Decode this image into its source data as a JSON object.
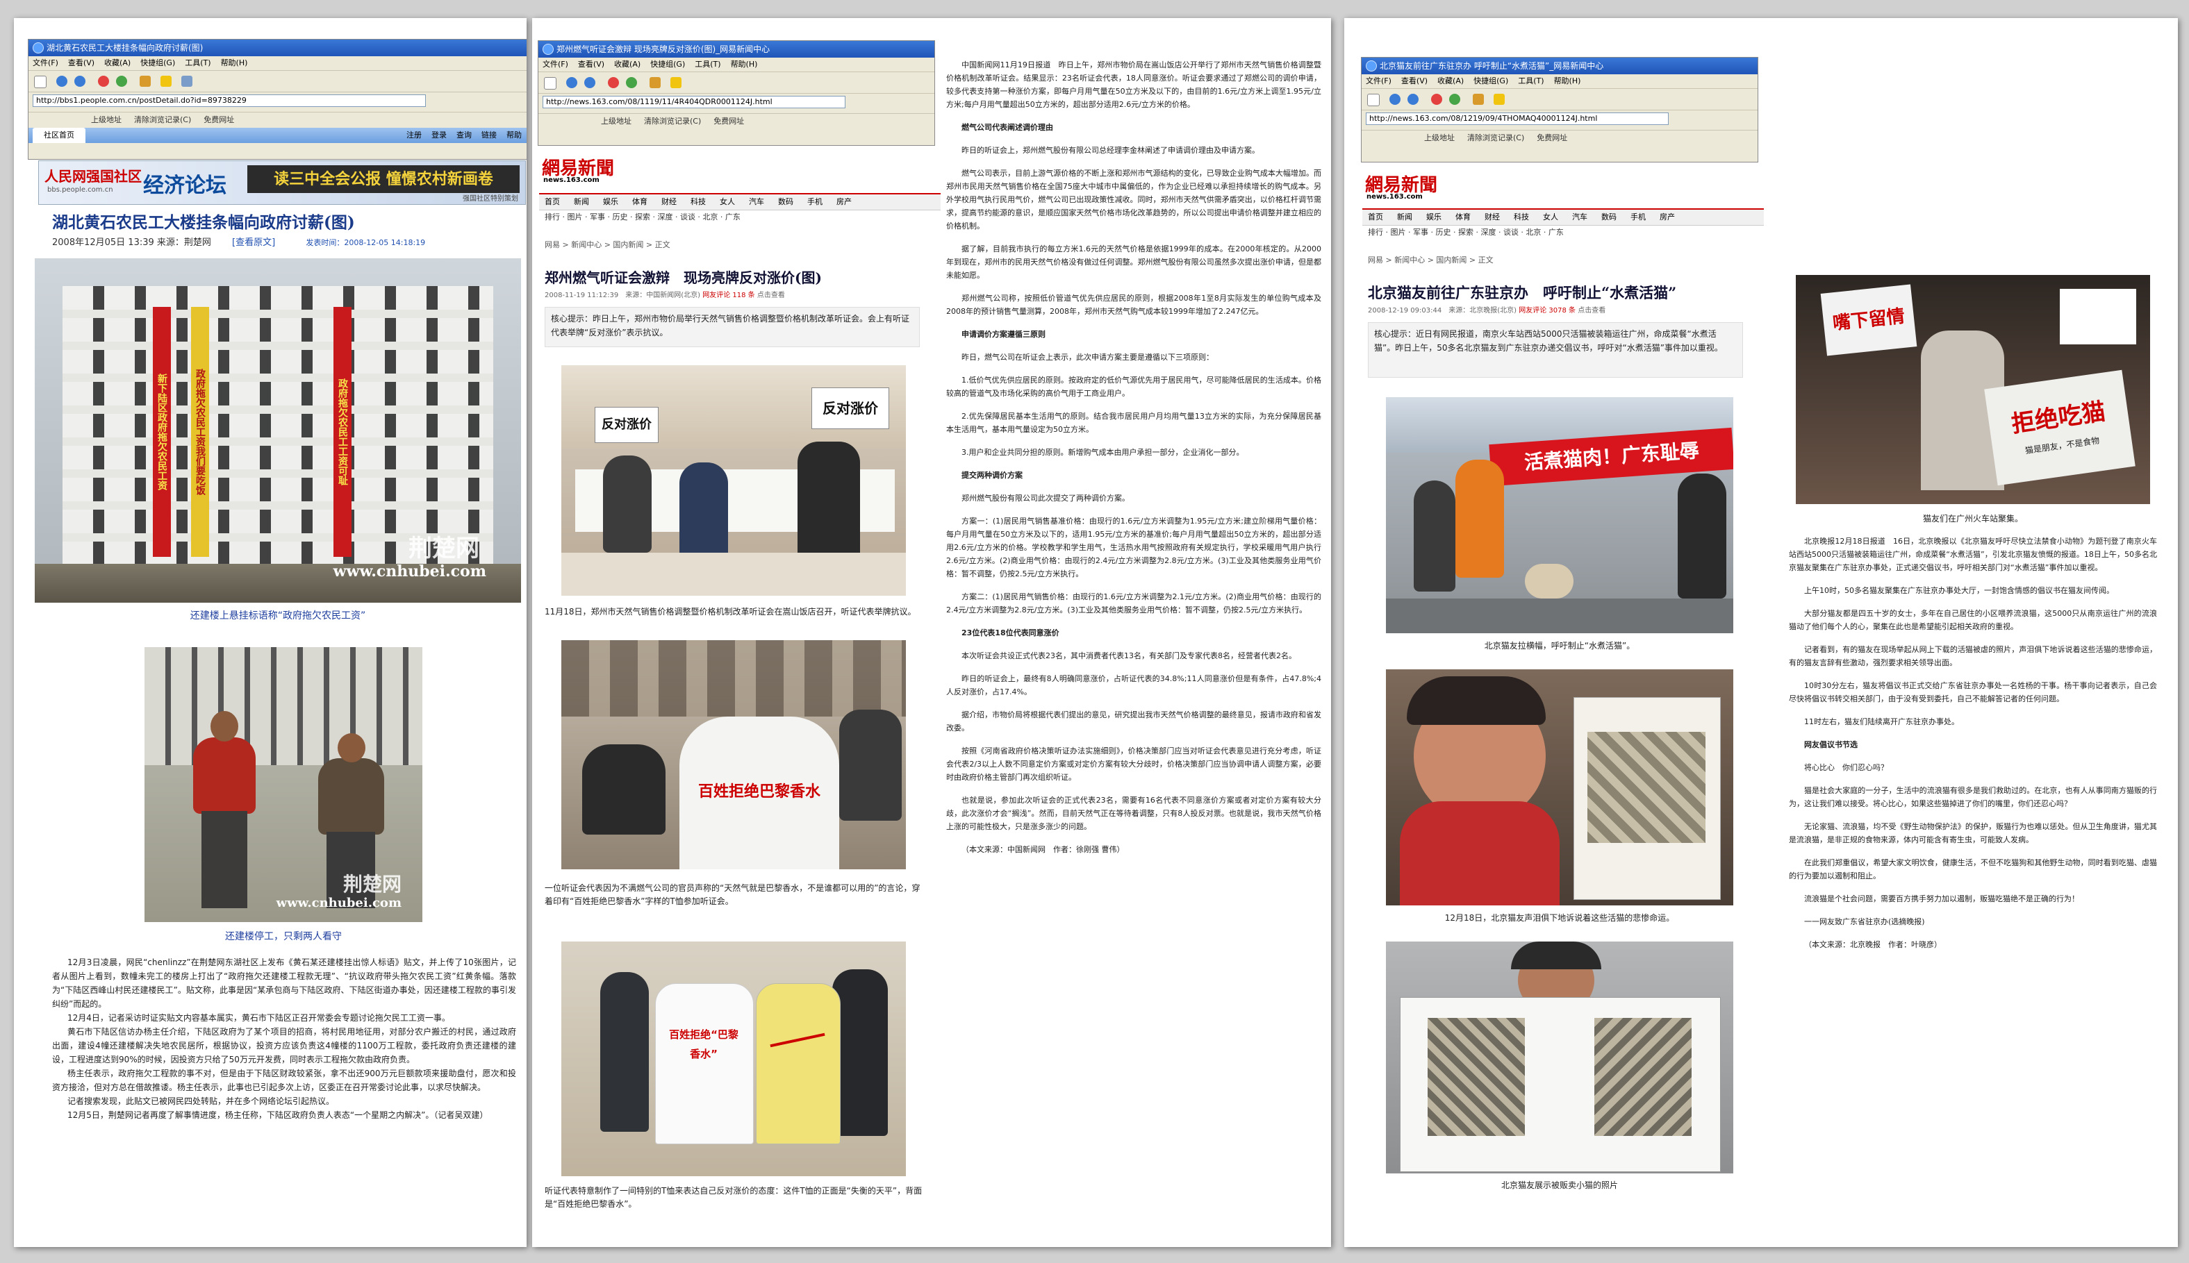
{
  "p1": {
    "window_title": "湖北黄石农民工大楼挂条幅向政府讨薪(图)",
    "menu": [
      "文件(F)",
      "查看(V)",
      "收藏(A)",
      "快捷组(G)",
      "工具(T)",
      "帮助(H)"
    ],
    "address": "http://bbs1.people.com.cn/postDetail.do?id=89738229",
    "links": [
      "上级地址",
      "清除浏览记录(C)",
      "免费网址"
    ],
    "tab_label": "社区首页",
    "tab_links": [
      "注册",
      "登录",
      "查询",
      "链接",
      "帮助"
    ],
    "banner_site": "人民网强国社区",
    "banner_site_url": "bbs.people.com.cn",
    "banner_section": "经济论坛",
    "banner_slogan": "读三中全会公报 憧憬农村新画卷",
    "banner_note": "强国社区特别策划",
    "headline": "湖北黄石农民工大楼挂条幅向政府讨薪(图)",
    "meta_date": "2008年12月05日 13:39 来源：荆楚网",
    "meta_view": "[查看原文]",
    "meta_post": "发表时间：2008-12-05 14:18:19",
    "banner_texts": [
      "新下陆区政府拖欠农民工资",
      "政府拖欠农民工资我们要吃饭",
      "政府拖欠农民工工资可耻"
    ],
    "watermark_logo": "荆楚网",
    "watermark_url": "www.cnhubei.com",
    "cap1": "还建楼上悬挂标语称“政府拖欠农民工资”",
    "cap2": "还建楼停工，只剩两人看守",
    "paras": [
      "12月3日凌晨，网民“chenlinzz”在荆楚网东湖社区上发布《黄石某还建楼挂出惊人标语》贴文，并上传了10张图片，记者从图片上看到，数幢未完工的楼房上打出了“政府拖欠还建楼工程款无理”、“抗议政府带头拖欠农民工资”红黄条幅。落款为“下陆区西峰山村民还建楼民工”。贴文称，此事是因“某承包商与下陆区政府、下陆区街道办事处，因还建楼工程款的事引发纠纷”而起的。",
      "12月4日，记者采访时证实贴文内容基本属实，黄石市下陆区正召开常委会专题讨论拖欠民工工资一事。",
      "黄石市下陆区信访办杨主任介绍，下陆区政府为了某个项目的招商，将村民用地征用，对部分农户搬迁的村民，通过政府出面，建设4幢还建楼解决失地农民居所，根据协议，投资方应该负责这4幢楼的1100万工程款，委托政府负责还建楼的建设，工程进度达到90%的时候，因投资方只给了50万元开发费，同时表示工程拖欠款由政府负责。",
      "杨主任表示，政府拖欠工程款的事不对，但是由于下陆区财政较紧张，拿不出还900万元巨额款项来援助盘付，愿次和投资方接洽，但对方总在借故推诿。杨主任表示，此事也已引起多次上访，区委正在召开常委讨论此事，以求尽快解决。",
      "记者搜索发现，此贴文已被网民四处转贴，并在多个网络论坛引起热议。",
      "12月5日，荆楚网记者再度了解事情进度，杨主任称，下陆区政府负责人表态“一个星期之内解决”。（记者吴双建）"
    ]
  },
  "p2": {
    "window_title": "郑州燃气听证会激辩 现场亮牌反对涨价(图)_网易新闻中心",
    "menu": [
      "文件(F)",
      "查看(V)",
      "收藏(A)",
      "快捷组(G)",
      "工具(T)",
      "帮助(H)"
    ],
    "address": "http://news.163.com/08/1119/11/4R404QDR0001124J.html",
    "links": [
      "上级地址",
      "清除浏览记录(C)",
      "免费网址"
    ],
    "logo": "網易新聞",
    "logo_sub": "news.163.com",
    "nav1": [
      "首页",
      "新闻",
      "娱乐",
      "体育",
      "财经",
      "科技",
      "女人",
      "汽车",
      "数码",
      "手机",
      "房产"
    ],
    "nav2": "排行 · 图片 · 军事 · 历史 · 探索 · 深度 · 谈谈 · 北京 · 广东",
    "crumb": "网易 > 新闻中心 > 国内新闻 > 正文",
    "headline": "郑州燃气听证会激辩　现场亮牌反对涨价(图)",
    "meta": "2008-11-19 11:12:39　来源：中国新闻网(北京)",
    "meta_red": "网友评论 118 条",
    "meta_tail": "点击查看",
    "summary": "核心提示：昨日上午，郑州市物价局举行天然气销售价格调整暨价格机制改革听证会。会上有听证代表举牌“反对涨价”表示抗议。",
    "sign1": "反对涨价",
    "sign2": "百姓拒绝巴黎香水",
    "shirt_text": "百姓拒绝“巴黎香水”",
    "cap1": "11月18日，郑州市天然气销售价格调整暨价格机制改革听证会在嵩山饭店召开，听证代表举牌抗议。",
    "cap2": "一位听证会代表因为不满燃气公司的官员声称的“天然气就是巴黎香水，不是谁都可以用的”的言论，穿着印有“百姓拒绝巴黎香水”字样的T恤参加听证会。",
    "cap3": "听证代表特意制作了一间特别的T恤来表达自己反对涨价的态度：这件T恤的正面是“失衡的天平”，背面是“百姓拒绝巴黎香水”。",
    "body": [
      {
        "h": false,
        "t": "中国新闻网11月19日报道　昨日上午，郑州市物价局在嵩山饭店公开举行了郑州市天然气销售价格调整暨价格机制改革听证会。结果显示：23名听证会代表，18人同意涨价。听证会要求通过了郑燃公司的调价申请，较多代表支持第一种涨价方案，即每户月用气量在50立方米及以下的，由目前的1.6元/立方米上调至1.95元/立方米;每户月用气量超出50立方米的，超出部分适用2.6元/立方米的价格。"
      },
      {
        "h": true,
        "t": "燃气公司代表阐述调价理由"
      },
      {
        "h": false,
        "t": "昨日的听证会上，郑州燃气股份有限公司总经理李金林阐述了申请调价理由及申请方案。"
      },
      {
        "h": false,
        "t": "燃气公司表示，目前上游气源价格的不断上涨和郑州市气源结构的变化，已导致企业购气成本大幅增加。而郑州市民用天然气销售价格在全国75座大中城市中属偏低的，作为企业已经难以承担持续增长的购气成本。另外学校用气执行民用气价，燃气公司已出现政策性减收。同时，郑州市天然气供需矛盾突出，以价格杠杆调节需求，提高节约能源的意识，是顺应国家天然气价格市场化改革趋势的，所以公司提出申请价格调整并建立相应的价格机制。"
      },
      {
        "h": false,
        "t": "据了解，目前我市执行的每立方米1.6元的天然气价格是依据1999年的成本。在2000年核定的。从2000年到现在，郑州市的民用天然气价格没有做过任何调整。郑州燃气股份有限公司虽然多次提出涨价申请，但是都未能如愿。"
      },
      {
        "h": false,
        "t": "郑州燃气公司称，按照低价管道气优先供应居民的原则，根据2008年1至8月实际发生的单位购气成本及2008年的预计销售气量测算，2008年，郑州市天然气购气成本较1999年增加了2.247亿元。"
      },
      {
        "h": true,
        "t": "申请调价方案遵循三原则"
      },
      {
        "h": false,
        "t": "昨日，燃气公司在听证会上表示，此次申请方案主要是遵循以下三项原则："
      },
      {
        "h": false,
        "t": "1.低价气优先供应居民的原则。按政府定的低价气源优先用于居民用气，尽可能降低居民的生活成本。价格较高的管道气及市场化采购的高价气用于工商业用户。"
      },
      {
        "h": false,
        "t": "2.优先保障居民基本生活用气的原则。结合我市居民用户月均用气量13立方米的实际，为充分保障居民基本生活用气，基本用气量设定为50立方米。"
      },
      {
        "h": false,
        "t": "3.用户和企业共同分担的原则。新增购气成本由用户承担一部分，企业消化一部分。"
      },
      {
        "h": true,
        "t": "提交两种调价方案"
      },
      {
        "h": false,
        "t": "郑州燃气股份有限公司此次提交了两种调价方案。"
      },
      {
        "h": false,
        "t": "方案一：(1)居民用气销售基准价格：由现行的1.6元/立方米调整为1.95元/立方米;建立阶梯用气量价格：每户月用气量在50立方米及以下的，适用1.95元/立方米的基准价;每户月用气量超出50立方米的，超出部分适用2.6元/立方米的价格。学校教学和学生用气，生活热水用气按照政府有关规定执行，学校采暖用气用户执行2.6元/立方米。(2)商业用气价格：由现行的2.4元/立方米调整为2.8元/立方米。(3)工业及其他类服务业用气价格：暂不调整，仍按2.5元/立方米执行。"
      },
      {
        "h": false,
        "t": "方案二：(1)居民用气销售价格：由现行的1.6元/立方米调整为2.1元/立方米。(2)商业用气价格：由现行的2.4元/立方米调整为2.8元/立方米。(3)工业及其他类服务业用气价格：暂不调整，仍按2.5元/立方米执行。"
      },
      {
        "h": true,
        "t": "23位代表18位代表同意涨价"
      },
      {
        "h": false,
        "t": "本次听证会共设正式代表23名，其中消费者代表13名，有关部门及专家代表8名，经营者代表2名。"
      },
      {
        "h": false,
        "t": "昨日的听证会上，最终有8人明确同意涨价，占听证代表的34.8%;11人同意涨价但是有条件，占47.8%;4人反对涨价，占17.4%。"
      },
      {
        "h": false,
        "t": "据介绍，市物价局将根据代表们提出的意见，研究提出我市天然气价格调整的最终意见，报请市政府和省发改委。"
      },
      {
        "h": false,
        "t": "按照《河南省政府价格决策听证办法实施细则》，价格决策部门应当对听证会代表意见进行充分考虑，听证会代表2/3以上人数不同意定价方案或对定价方案有较大分歧时，价格决策部门应当协调申请人调整方案，必要时由政府价格主管部门再次组织听证。"
      },
      {
        "h": false,
        "t": "也就是说，参加此次听证会的正式代表23名，需要有16名代表不同意涨价方案或者对定价方案有较大分歧，此次涨价才会“搁浅”。然而，目前天然气正在等待着调整，只有8人投反对票。也就是说，我市天然气价格上涨的可能性极大，只是涨多涨少的问题。"
      },
      {
        "h": false,
        "t": "（本文来源：中国新闻网　作者：徐刚强 曹伟）"
      }
    ]
  },
  "p3": {
    "window_title": "北京猫友前往广东驻京办 呼吁制止“水煮活猫”_网易新闻中心",
    "menu": [
      "文件(F)",
      "查看(V)",
      "收藏(A)",
      "快捷组(G)",
      "工具(T)",
      "帮助(H)"
    ],
    "address": "http://news.163.com/08/1219/09/4THOMAQ40001124J.html",
    "links": [
      "上级地址",
      "清除浏览记录(C)",
      "免费网址"
    ],
    "logo": "網易新聞",
    "logo_sub": "news.163.com",
    "nav1": [
      "首页",
      "新闻",
      "娱乐",
      "体育",
      "财经",
      "科技",
      "女人",
      "汽车",
      "数码",
      "手机",
      "房产"
    ],
    "nav2": "排行 · 图片 · 军事 · 历史 · 探索 · 深度 · 谈谈 · 北京 · 广东",
    "crumb": "网易 > 新闻中心 > 国内新闻 > 正文",
    "headline": "北京猫友前往广东驻京办　呼吁制止“水煮活猫”",
    "meta": "2008-12-19 09:03:44　来源：北京晚报(北京)",
    "meta_red": "网友评论 3078 条",
    "meta_tail": "点击查看",
    "summary": "核心提示：近日有网民报道，南京火车站西站5000只活猫被装箱运往广州，命成菜餐“水煮活猫”。昨日上午，50多名北京猫友到广东驻京办递交倡议书，呼吁对“水煮活猫”事件加以重视。",
    "banner_red": "活煮猫肉！广东耻辱",
    "sign_reject": "拒绝吃猫",
    "sign_reject_sub": "猫是朋友，不是食物",
    "sign_mouth": "嘴下留情",
    "cap1": "北京猫友拉横幅，呼吁制止“水煮活猫”。",
    "cap2": "12月18日，北京猫友声泪俱下地诉说着这些活猫的悲惨命运。",
    "cap3": "北京猫友展示被贩卖小猫的照片",
    "cap4": "猫友们在广州火车站聚集。",
    "body": [
      {
        "h": false,
        "t": "北京晚报12月18日报道　16日，北京晚报以《北京猫友呼吁尽快立法禁食小动物》为题刊登了南京火车站西站5000只活猫被装箱运往广州，命成菜餐“水煮活猫”，引发北京猫友愤慨的报道。18日上午，50多名北京猫友聚集在广东驻京办事处，正式递交倡议书，呼吁相关部门对“水煮活猫”事件加以重视。"
      },
      {
        "h": false,
        "t": "上午10时，50多名猫友聚集在广东驻京办事处大厅，一封饱含情感的倡议书在猫友间传阅。"
      },
      {
        "h": false,
        "t": "大部分猫友都是四五十岁的女士，多年在自己居住的小区喂养流浪猫，这5000只从南京运往广州的流浪猫动了他们每个人的心，聚集在此也是希望能引起相关政府的重视。"
      },
      {
        "h": false,
        "t": "记者看到，有的猫友在现场举起从网上下载的活猫被虐的照片，声泪俱下地诉说着这些活猫的悲惨命运，有的猫友言辞有些激动，强烈要求相关领导出面。"
      },
      {
        "h": false,
        "t": "10时30分左右，猫友将倡议书正式交给广东省驻京办事处一名姓杨的干事。杨干事向记者表示，自己会尽快将倡议书转交相关部门，由于没有受到委托，自己不能解答记者的任何问题。"
      },
      {
        "h": false,
        "t": "11时左右，猫友们陆续离开广东驻京办事处。"
      },
      {
        "h": true,
        "t": "网友倡议书节选"
      },
      {
        "h": false,
        "t": "将心比心　你们忍心吗？"
      },
      {
        "h": false,
        "t": "猫是社会大家庭的一分子，生活中的流浪猫有很多是我们救助过的。在北京，也有人从事同南方猫贩的行为，这让我们难以接受。将心比心，如果这些猫掉进了你们的嘴里，你们还忍心吗？"
      },
      {
        "h": false,
        "t": "无论家猫、流浪猫，均不受《野生动物保护法》的保护，贩猫行为也难以惩处。但从卫生角度讲，猫尤其是流浪猫，是非正规的食物来源，体内可能含有寄生虫，可能致人发病。"
      },
      {
        "h": false,
        "t": "在此我们郑重倡议，希望大家文明饮食，健康生活，不但不吃猫狗和其他野生动物，同时看到吃猫、虐猫的行为要加以遏制和阻止。"
      },
      {
        "h": false,
        "t": "流浪猫是个社会问题，需要百方携手努力加以遏制，贩猫吃猫绝不是正确的行为！"
      },
      {
        "h": false,
        "t": "一一网友致广东省驻京办(选摘晚报)"
      },
      {
        "h": false,
        "t": "（本文来源：北京晚报　作者：叶晓彦）"
      }
    ]
  }
}
